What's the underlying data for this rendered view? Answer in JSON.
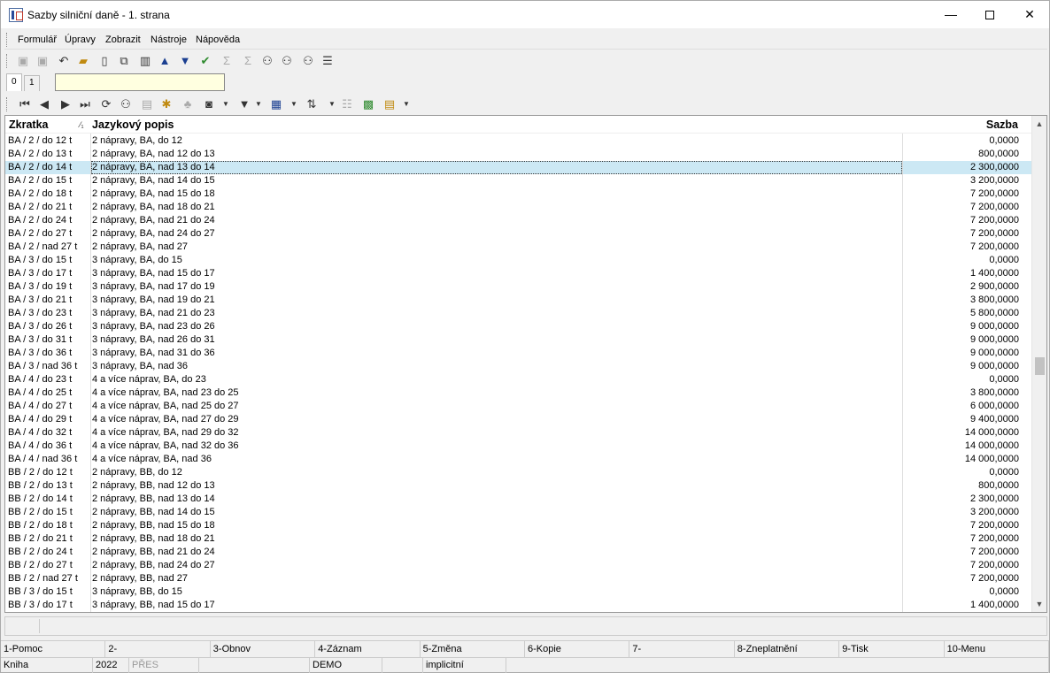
{
  "window": {
    "title": "Sazby silniční daně - 1. strana"
  },
  "menu": [
    "Formulář",
    "Úpravy",
    "Zobrazit",
    "Nástroje",
    "Nápověda"
  ],
  "toolbar1": [
    {
      "name": "save-icon",
      "glyph": "▣",
      "style": "dim"
    },
    {
      "name": "save-as-icon",
      "glyph": "▣",
      "style": "dim"
    },
    {
      "name": "undo-icon",
      "glyph": "↶",
      "style": ""
    },
    {
      "name": "open-folder-icon",
      "glyph": "▰",
      "style": "gold"
    },
    {
      "name": "new-document-icon",
      "glyph": "▯",
      "style": ""
    },
    {
      "name": "copy-icon",
      "glyph": "⧉",
      "style": ""
    },
    {
      "name": "book-icon",
      "glyph": "▥",
      "style": ""
    },
    {
      "name": "arrow-up-icon",
      "glyph": "▲",
      "style": "blue"
    },
    {
      "name": "arrow-down-icon",
      "glyph": "▼",
      "style": "blue"
    },
    {
      "name": "checkmark-icon",
      "glyph": "✔",
      "style": "green"
    },
    {
      "name": "sum-icon",
      "glyph": "Σ",
      "style": "dim"
    },
    {
      "name": "sum-selected-icon",
      "glyph": "Σ",
      "style": "dim"
    },
    {
      "name": "binoculars-icon",
      "glyph": "⚇",
      "style": ""
    },
    {
      "name": "find-next-icon",
      "glyph": "⚇",
      "style": ""
    },
    {
      "name": "find-replace-icon",
      "glyph": "⚇",
      "style": ""
    },
    {
      "name": "hamburger-menu-icon",
      "glyph": "☰",
      "style": ""
    }
  ],
  "tabs": [
    "0",
    "1"
  ],
  "toolbar2": [
    {
      "name": "first-record-icon",
      "glyph": "⏮",
      "style": ""
    },
    {
      "name": "previous-record-icon",
      "glyph": "◀",
      "style": ""
    },
    {
      "name": "next-record-icon",
      "glyph": "▶",
      "style": ""
    },
    {
      "name": "last-record-icon",
      "glyph": "⏭",
      "style": ""
    },
    {
      "name": "refresh-icon",
      "glyph": "⟳",
      "style": ""
    },
    {
      "name": "binoculars-icon",
      "glyph": "⚇",
      "style": ""
    },
    {
      "name": "print-icon",
      "glyph": "▤",
      "style": "dim"
    },
    {
      "name": "add-star-icon",
      "glyph": "✱",
      "style": "gold"
    },
    {
      "name": "tree-icon",
      "glyph": "♣",
      "style": "dim"
    },
    {
      "name": "camera-icon",
      "glyph": "◙",
      "style": ""
    },
    {
      "name": "filter-icon",
      "glyph": "▼",
      "style": ""
    },
    {
      "name": "columns-icon",
      "glyph": "▦",
      "style": "blue"
    },
    {
      "name": "sort-az-icon",
      "glyph": "⇅",
      "style": ""
    },
    {
      "name": "list-icon",
      "glyph": "☷",
      "style": "dim"
    },
    {
      "name": "excel-icon",
      "glyph": "▩",
      "style": "green"
    },
    {
      "name": "notepad-icon",
      "glyph": "▤",
      "style": "gold"
    }
  ],
  "grid": {
    "headers": {
      "zkratka": "Zkratka",
      "sort": "⁄₁",
      "popis": "Jazykový popis",
      "sazba": "Sazba"
    },
    "rows": [
      [
        "BA / 2 / do 12 t",
        "2 nápravy, BA, do 12",
        "0,0000"
      ],
      [
        "BA / 2 / do 13 t",
        "2 nápravy, BA, nad 12 do 13",
        "800,0000"
      ],
      [
        "BA / 2 / do 14 t",
        "2 nápravy, BA, nad 13 do 14",
        "2 300,0000"
      ],
      [
        "BA / 2 / do 15 t",
        "2 nápravy, BA, nad 14 do 15",
        "3 200,0000"
      ],
      [
        "BA / 2 / do 18 t",
        "2 nápravy, BA, nad 15 do 18",
        "7 200,0000"
      ],
      [
        "BA / 2 / do 21 t",
        "2 nápravy, BA, nad 18 do 21",
        "7 200,0000"
      ],
      [
        "BA / 2 / do 24 t",
        "2 nápravy, BA, nad 21 do 24",
        "7 200,0000"
      ],
      [
        "BA / 2 / do 27 t",
        "2 nápravy, BA, nad 24 do 27",
        "7 200,0000"
      ],
      [
        "BA / 2 / nad 27 t",
        "2 nápravy, BA, nad 27",
        "7 200,0000"
      ],
      [
        "BA / 3 / do 15 t",
        "3 nápravy, BA, do 15",
        "0,0000"
      ],
      [
        "BA / 3 / do 17 t",
        "3 nápravy, BA, nad 15 do 17",
        "1 400,0000"
      ],
      [
        "BA / 3 / do 19 t",
        "3 nápravy, BA, nad 17 do 19",
        "2 900,0000"
      ],
      [
        "BA / 3 / do 21 t",
        "3 nápravy, BA, nad 19 do 21",
        "3 800,0000"
      ],
      [
        "BA / 3 / do 23 t",
        "3 nápravy, BA, nad 21 do 23",
        "5 800,0000"
      ],
      [
        "BA / 3 / do 26 t",
        "3 nápravy, BA, nad 23 do 26",
        "9 000,0000"
      ],
      [
        "BA / 3 / do 31 t",
        "3 nápravy, BA, nad 26 do 31",
        "9 000,0000"
      ],
      [
        "BA / 3 / do 36 t",
        "3 nápravy, BA, nad 31 do 36",
        "9 000,0000"
      ],
      [
        "BA / 3 / nad 36 t",
        "3 nápravy, BA, nad 36",
        "9 000,0000"
      ],
      [
        "BA / 4 / do 23 t",
        "4 a více náprav, BA, do 23",
        "0,0000"
      ],
      [
        "BA / 4 / do 25 t",
        "4 a více náprav, BA, nad 23 do 25",
        "3 800,0000"
      ],
      [
        "BA / 4 / do 27 t",
        "4 a více náprav, BA, nad 25 do 27",
        "6 000,0000"
      ],
      [
        "BA / 4 / do 29 t",
        "4 a více náprav, BA, nad 27 do 29",
        "9 400,0000"
      ],
      [
        "BA / 4 / do 32 t",
        "4 a více náprav, BA, nad 29 do 32",
        "14 000,0000"
      ],
      [
        "BA / 4 / do 36 t",
        "4 a více náprav, BA, nad 32 do 36",
        "14 000,0000"
      ],
      [
        "BA / 4 / nad 36 t",
        "4 a více náprav, BA, nad 36",
        "14 000,0000"
      ],
      [
        "BB / 2 / do 12 t",
        "2 nápravy, BB, do 12",
        "0,0000"
      ],
      [
        "BB / 2 / do 13 t",
        "2 nápravy, BB, nad 12 do 13",
        "800,0000"
      ],
      [
        "BB / 2 / do 14 t",
        "2 nápravy, BB, nad 13 do 14",
        "2 300,0000"
      ],
      [
        "BB / 2 / do 15 t",
        "2 nápravy, BB, nad 14 do 15",
        "3 200,0000"
      ],
      [
        "BB / 2 / do 18 t",
        "2 nápravy, BB, nad 15 do 18",
        "7 200,0000"
      ],
      [
        "BB / 2 / do 21 t",
        "2 nápravy, BB, nad 18 do 21",
        "7 200,0000"
      ],
      [
        "BB / 2 / do 24 t",
        "2 nápravy, BB, nad 21 do 24",
        "7 200,0000"
      ],
      [
        "BB / 2 / do 27 t",
        "2 nápravy, BB, nad 24 do 27",
        "7 200,0000"
      ],
      [
        "BB / 2 / nad 27 t",
        "2 nápravy, BB, nad 27",
        "7 200,0000"
      ],
      [
        "BB / 3 / do 15 t",
        "3 nápravy, BB, do 15",
        "0,0000"
      ],
      [
        "BB / 3 / do 17 t",
        "3 nápravy, BB, nad 15 do 17",
        "1 400,0000"
      ]
    ],
    "selected_row": 2
  },
  "fkeys": [
    "1-Pomoc",
    "2-",
    "3-Obnov",
    "4-Záznam",
    "5-Změna",
    "6-Kopie",
    "7-",
    "8-Zneplatnění",
    "9-Tisk",
    "10-Menu"
  ],
  "infobar": [
    {
      "text": "Kniha",
      "dim": false
    },
    {
      "text": "2022",
      "dim": false
    },
    {
      "text": "PŘES",
      "dim": true
    },
    {
      "text": "",
      "dim": false
    },
    {
      "text": "DEMO",
      "dim": false
    },
    {
      "text": "",
      "dim": false
    },
    {
      "text": "implicitní",
      "dim": false
    },
    {
      "text": "",
      "dim": false
    }
  ]
}
